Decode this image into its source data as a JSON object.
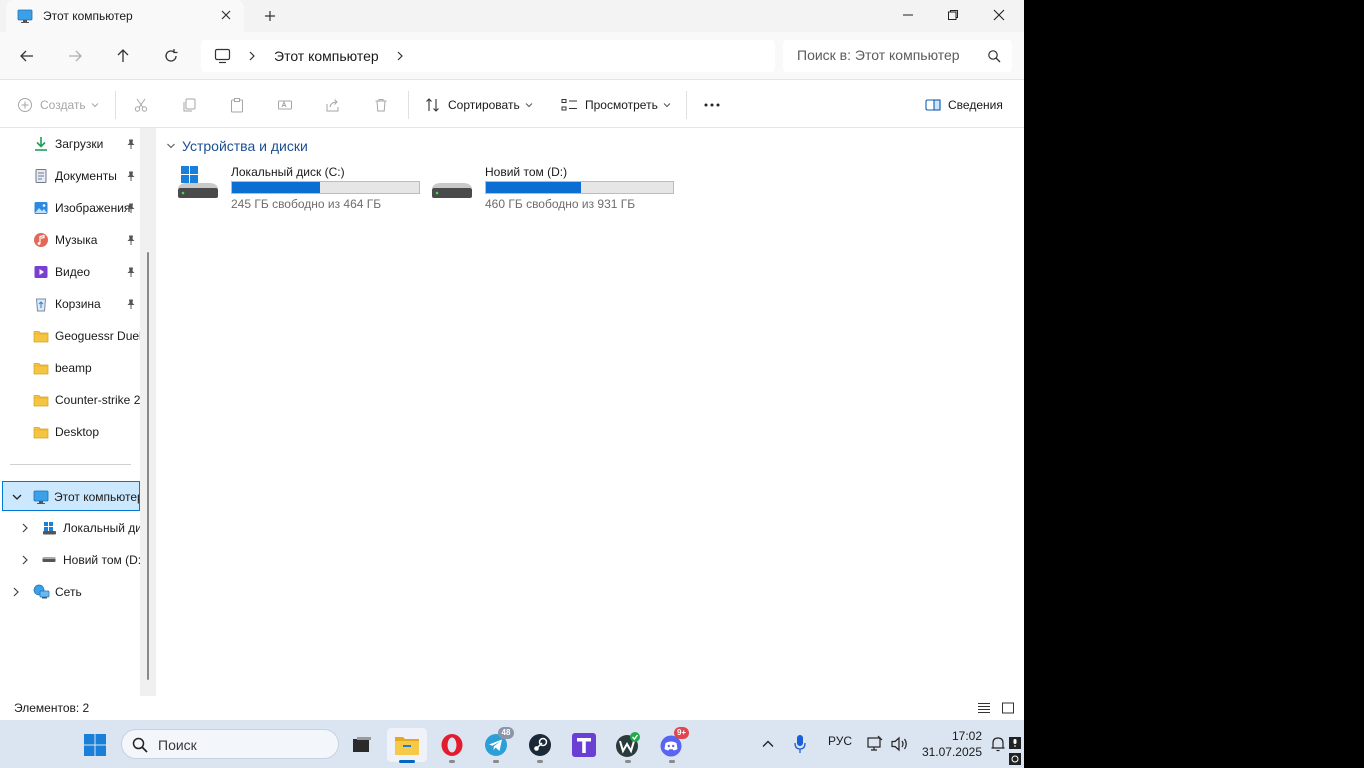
{
  "window": {
    "tab_title": "Этот компьютер"
  },
  "addressbar": {
    "breadcrumb": "Этот компьютер",
    "search_placeholder": "Поиск в: Этот компьютер"
  },
  "commandbar": {
    "create": "Создать",
    "sort": "Сортировать",
    "view": "Просмотреть",
    "details": "Сведения"
  },
  "sidebar": {
    "quick_access": [
      {
        "label": "Загрузки",
        "icon": "download-icon",
        "pinned": true
      },
      {
        "label": "Документы",
        "icon": "documents-icon",
        "pinned": true
      },
      {
        "label": "Изображения",
        "icon": "pictures-icon",
        "pinned": true
      },
      {
        "label": "Музыка",
        "icon": "music-icon",
        "pinned": true
      },
      {
        "label": "Видео",
        "icon": "videos-icon",
        "pinned": true
      },
      {
        "label": "Корзина",
        "icon": "recycle-bin-icon",
        "pinned": true
      },
      {
        "label": "Geoguessr Duels",
        "icon": "folder-icon",
        "pinned": false
      },
      {
        "label": "beamp",
        "icon": "folder-icon",
        "pinned": false
      },
      {
        "label": "Counter-strike 2",
        "icon": "folder-icon",
        "pinned": false
      },
      {
        "label": "Desktop",
        "icon": "folder-icon",
        "pinned": false
      }
    ],
    "tree": {
      "this_pc": "Этот компьютер",
      "drive_c": "Локальный диск (C:)",
      "drive_d": "Новий том (D:)",
      "network": "Сеть"
    }
  },
  "content": {
    "group_title": "Устройства и диски",
    "drives": [
      {
        "name": "Локальный диск (C:)",
        "free_text": "245 ГБ свободно из 464 ГБ",
        "used_fraction": 0.47
      },
      {
        "name": "Новий том (D:)",
        "free_text": "460 ГБ свободно из 931 ГБ",
        "used_fraction": 0.51
      }
    ]
  },
  "statusbar": {
    "item_count": "Элементов: 2"
  },
  "taskbar": {
    "search_label": "Поиск",
    "telegram_badge": "48",
    "discord_badge": "9+",
    "language": "РУС",
    "time": "17:02",
    "date": "31.07.2025"
  },
  "colors": {
    "accent": "#0078d4",
    "drive_bar_fill": "#0a6fd1",
    "group_header": "#1d4f91",
    "selection_bg": "#cce8ff"
  }
}
